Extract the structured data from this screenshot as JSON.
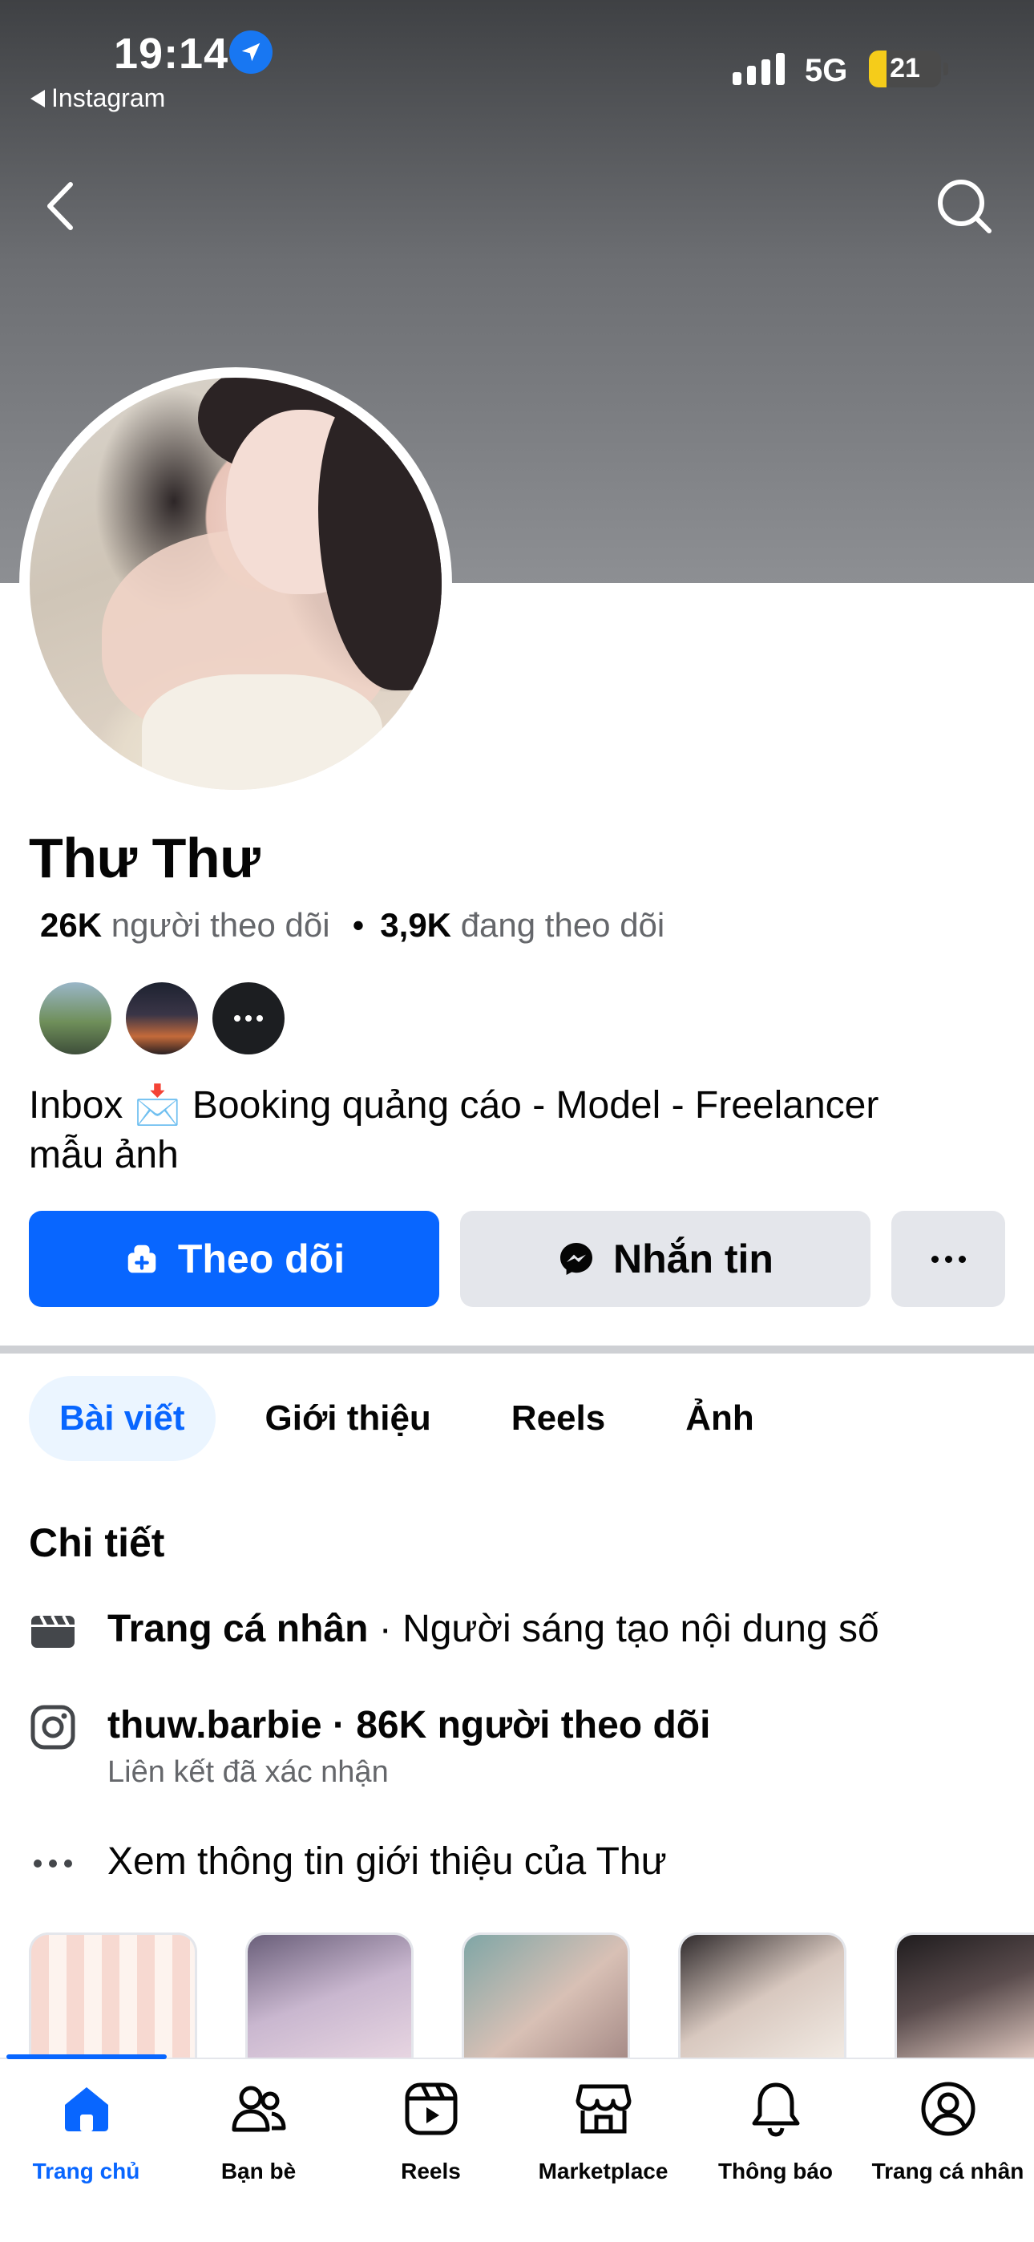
{
  "status_bar": {
    "time": "19:14",
    "back_app": "Instagram",
    "network": "5G",
    "battery": "21"
  },
  "profile": {
    "name": "Thư Thư",
    "followers_count": "26K",
    "followers_label": "người theo dõi",
    "following_count": "3,9K",
    "following_label": "đang theo dõi",
    "bio_line1": "Inbox 📩 Booking quảng cáo - Model - Freelancer",
    "bio_line2": "mẫu ảnh"
  },
  "actions": {
    "follow_label": "Theo dõi",
    "message_label": "Nhắn tin"
  },
  "tabs": [
    {
      "label": "Bài viết",
      "active": true
    },
    {
      "label": "Giới thiệu",
      "active": false
    },
    {
      "label": "Reels",
      "active": false
    },
    {
      "label": "Ảnh",
      "active": false
    }
  ],
  "details": {
    "title": "Chi tiết",
    "page_type_bold": "Trang cá nhân",
    "page_type_rest": " · Người sáng tạo nội dung số",
    "instagram_handle": "thuw.barbie · 86K người theo dõi",
    "instagram_sub": "Liên kết đã xác nhận",
    "see_more": "Xem thông tin giới thiệu của Thư"
  },
  "bottom_nav": [
    {
      "label": "Trang chủ",
      "icon": "home-icon",
      "active": true
    },
    {
      "label": "Bạn bè",
      "icon": "friends-icon",
      "active": false
    },
    {
      "label": "Reels",
      "icon": "reels-icon",
      "active": false
    },
    {
      "label": "Marketplace",
      "icon": "marketplace-icon",
      "active": false
    },
    {
      "label": "Thông báo",
      "icon": "bell-icon",
      "active": false
    },
    {
      "label": "Trang cá nhân",
      "icon": "profile-icon",
      "active": false
    }
  ],
  "colors": {
    "accent": "#0866ff",
    "secondary_button": "#e4e6eb",
    "muted_text": "#65676b"
  }
}
